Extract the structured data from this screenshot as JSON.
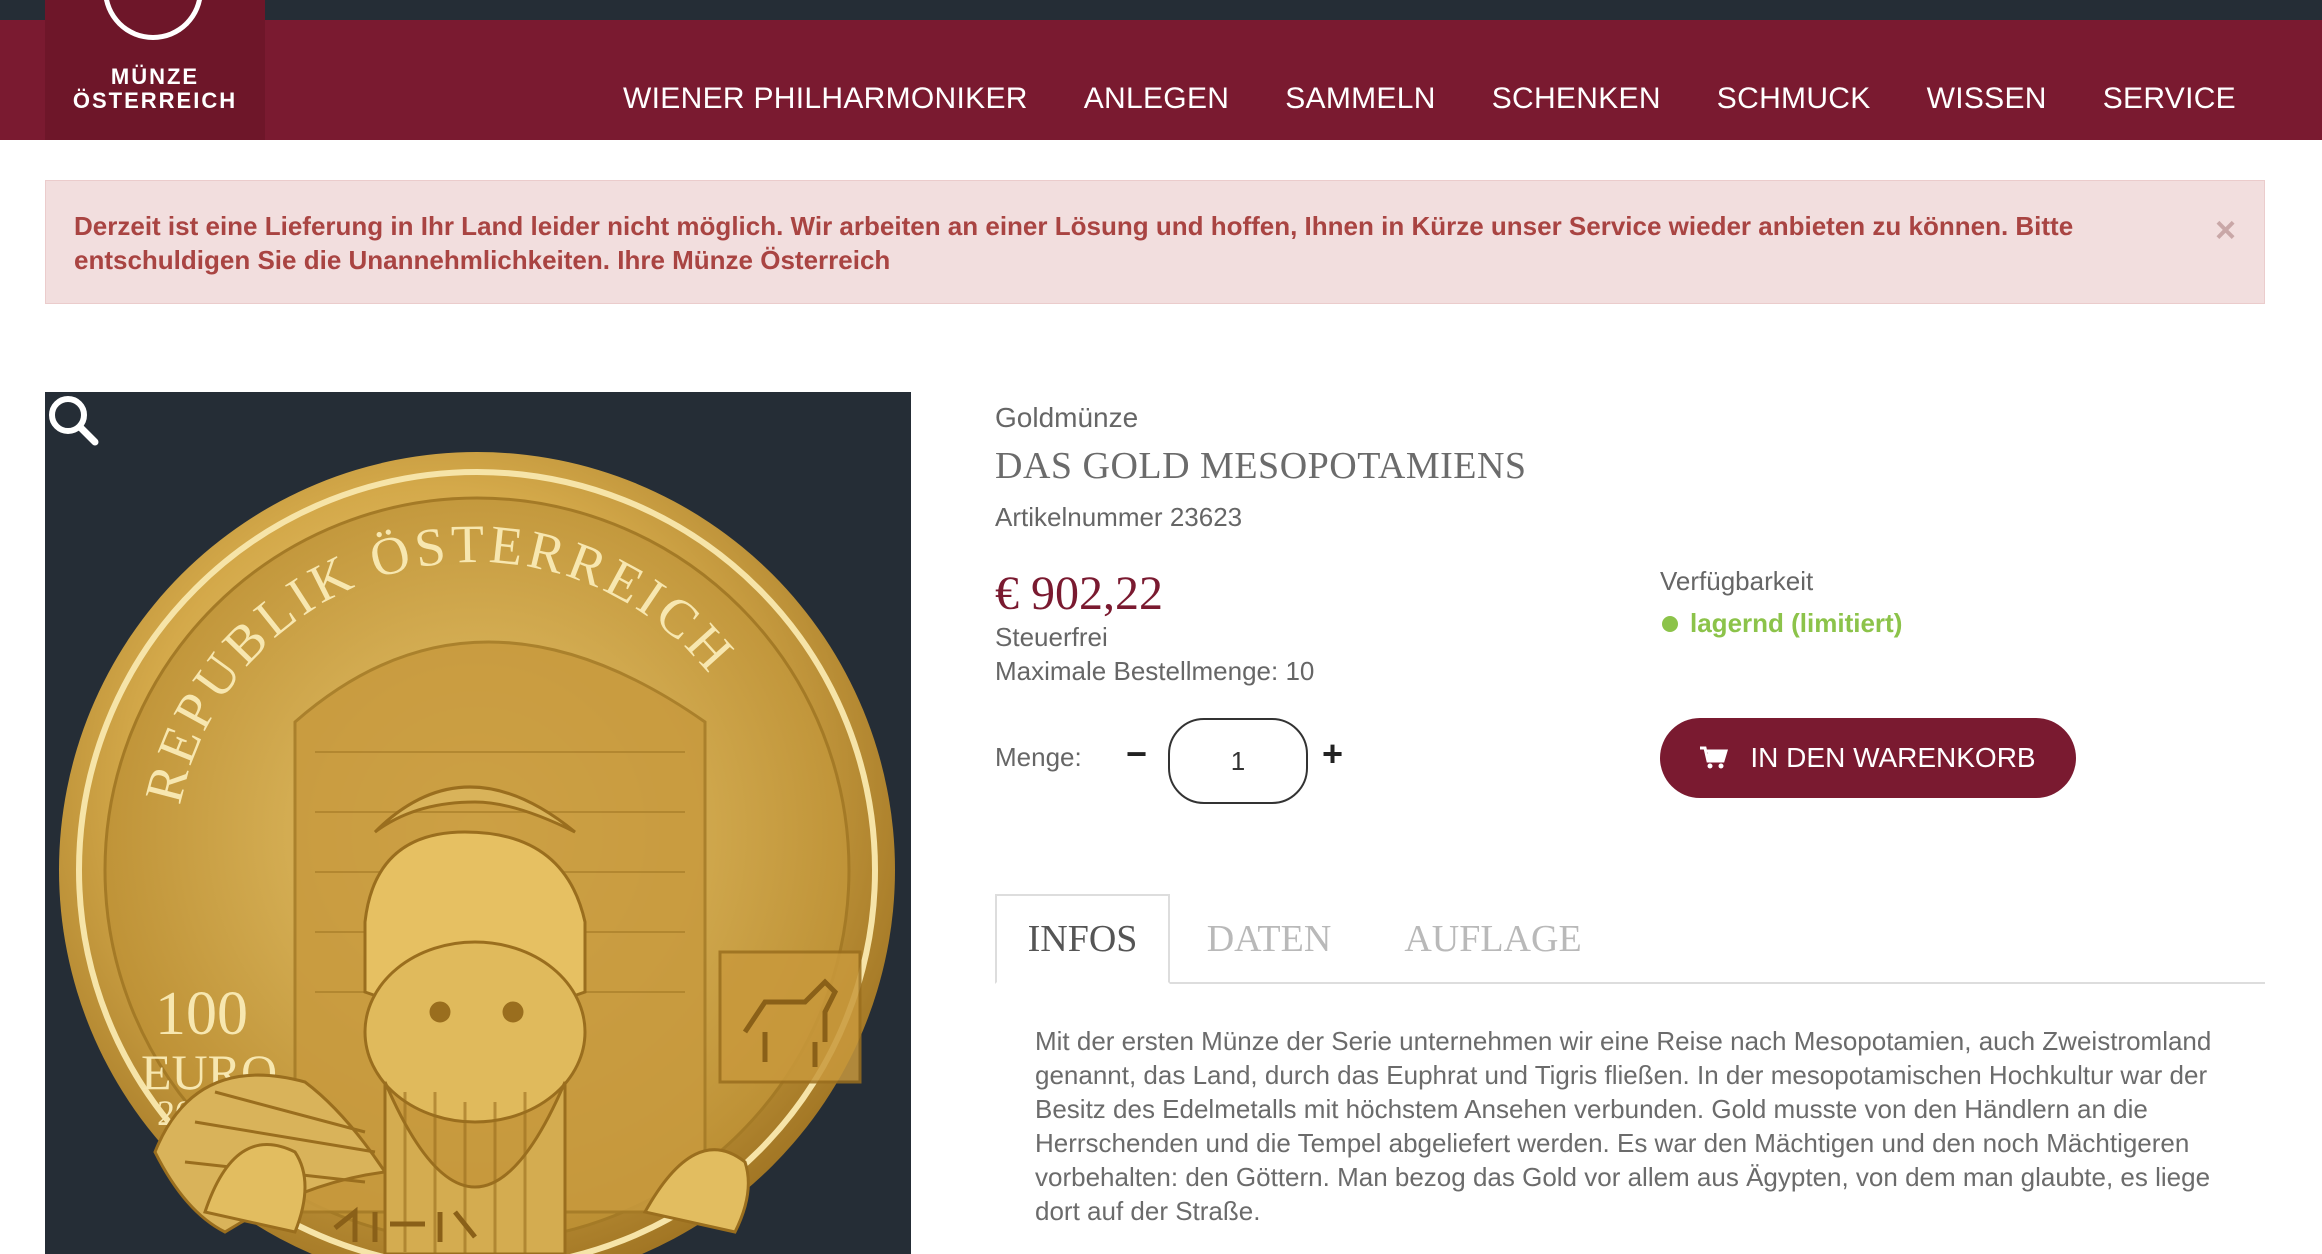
{
  "brand": {
    "line1": "MÜNZE",
    "line2": "ÖSTERREICH"
  },
  "nav": {
    "items": [
      {
        "label": "WIENER PHILHARMONIKER"
      },
      {
        "label": "ANLEGEN"
      },
      {
        "label": "SAMMELN"
      },
      {
        "label": "SCHENKEN"
      },
      {
        "label": "SCHMUCK"
      },
      {
        "label": "WISSEN"
      },
      {
        "label": "SERVICE"
      }
    ]
  },
  "alert": {
    "text": "Derzeit ist eine Lieferung in Ihr Land leider nicht möglich. Wir arbeiten an einer Lösung und hoffen, Ihnen in Kürze unser Service wieder anbieten zu können. Bitte entschuldigen Sie die Unannehmlichkeiten. Ihre Münze Österreich",
    "close": "×"
  },
  "coin": {
    "top_text": "REPUBLIK ÖSTERREICH",
    "denomination": "100",
    "currency": "EURO",
    "year": "2019"
  },
  "product": {
    "category": "Goldmünze",
    "title": "DAS GOLD MESOPOTAMIENS",
    "article": "Artikelnummer 23623",
    "price": "€  902,22",
    "tax": "Steuerfrei",
    "max_order": "Maximale Bestellmenge: 10",
    "availability_label": "Verfügbarkeit",
    "availability_status": "lagernd (limitiert)",
    "quantity_label": "Menge:",
    "quantity_value": "1",
    "minus": "−",
    "plus": "+",
    "cart_button": "IN DEN WARENKORB"
  },
  "tabs": [
    {
      "label": "INFOS",
      "active": true
    },
    {
      "label": "DATEN",
      "active": false
    },
    {
      "label": "AUFLAGE",
      "active": false
    }
  ],
  "description": "Mit der ersten Münze der Serie unternehmen wir eine Reise nach Mesopotamien, auch Zweistromland genannt, das Land, durch das Euphrat und Tigris fließen. In der mesopotamischen Hochkultur war der Besitz des Edelmetalls mit höchstem Ansehen verbunden. Gold musste von den Händlern an die Herrschenden und die Tempel abgeliefert werden. Es war den Mächtigen und den noch Mächtigeren vorbehalten: den Göttern. Man bezog das Gold vor allem aus Ägypten, von dem man glaubte, es liege dort auf der Straße.",
  "colors": {
    "header": "#7a1a30",
    "top_strip": "#252d36",
    "alert_bg": "#f2dede",
    "alert_text": "#a94442",
    "available": "#8cc34a",
    "price": "#7a1a30"
  },
  "icons": [
    "search-icon",
    "shopping-cart-icon",
    "close-icon",
    "logo-ring-icon"
  ]
}
